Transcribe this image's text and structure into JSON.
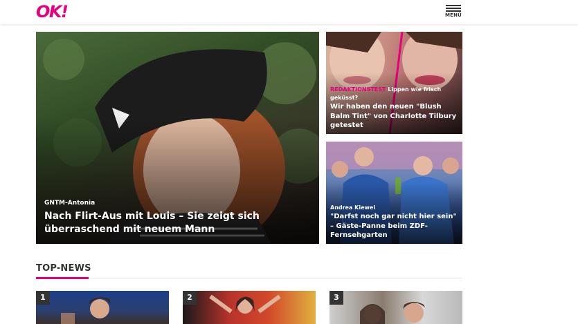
{
  "header": {
    "logo": "OK!",
    "menu_label": "MENÜ"
  },
  "hero": {
    "kicker": "GNTM-Antonia",
    "headline": "Nach Flirt-Aus mit Louis – Sie zeigt sich überraschend mit neuem Mann"
  },
  "side_cards": [
    {
      "kicker_label": "REDAKTIONSTEST",
      "kicker_rest": "Lippen wie frisch geküsst?",
      "headline": "Wir haben den neuen \"Blush Balm Tint\" von Charlotte Tilbury getestet"
    },
    {
      "kicker": "Andrea Kiewel",
      "headline": "\"Darfst noch gar nicht hier sein\" – Gäste-Panne beim ZDF-Fernsehgarten"
    }
  ],
  "top_news": {
    "title": "TOP-NEWS",
    "items": [
      {
        "number": "1"
      },
      {
        "number": "2"
      },
      {
        "number": "3"
      }
    ]
  },
  "colors": {
    "brand": "#e6007e",
    "text": "#333333"
  }
}
